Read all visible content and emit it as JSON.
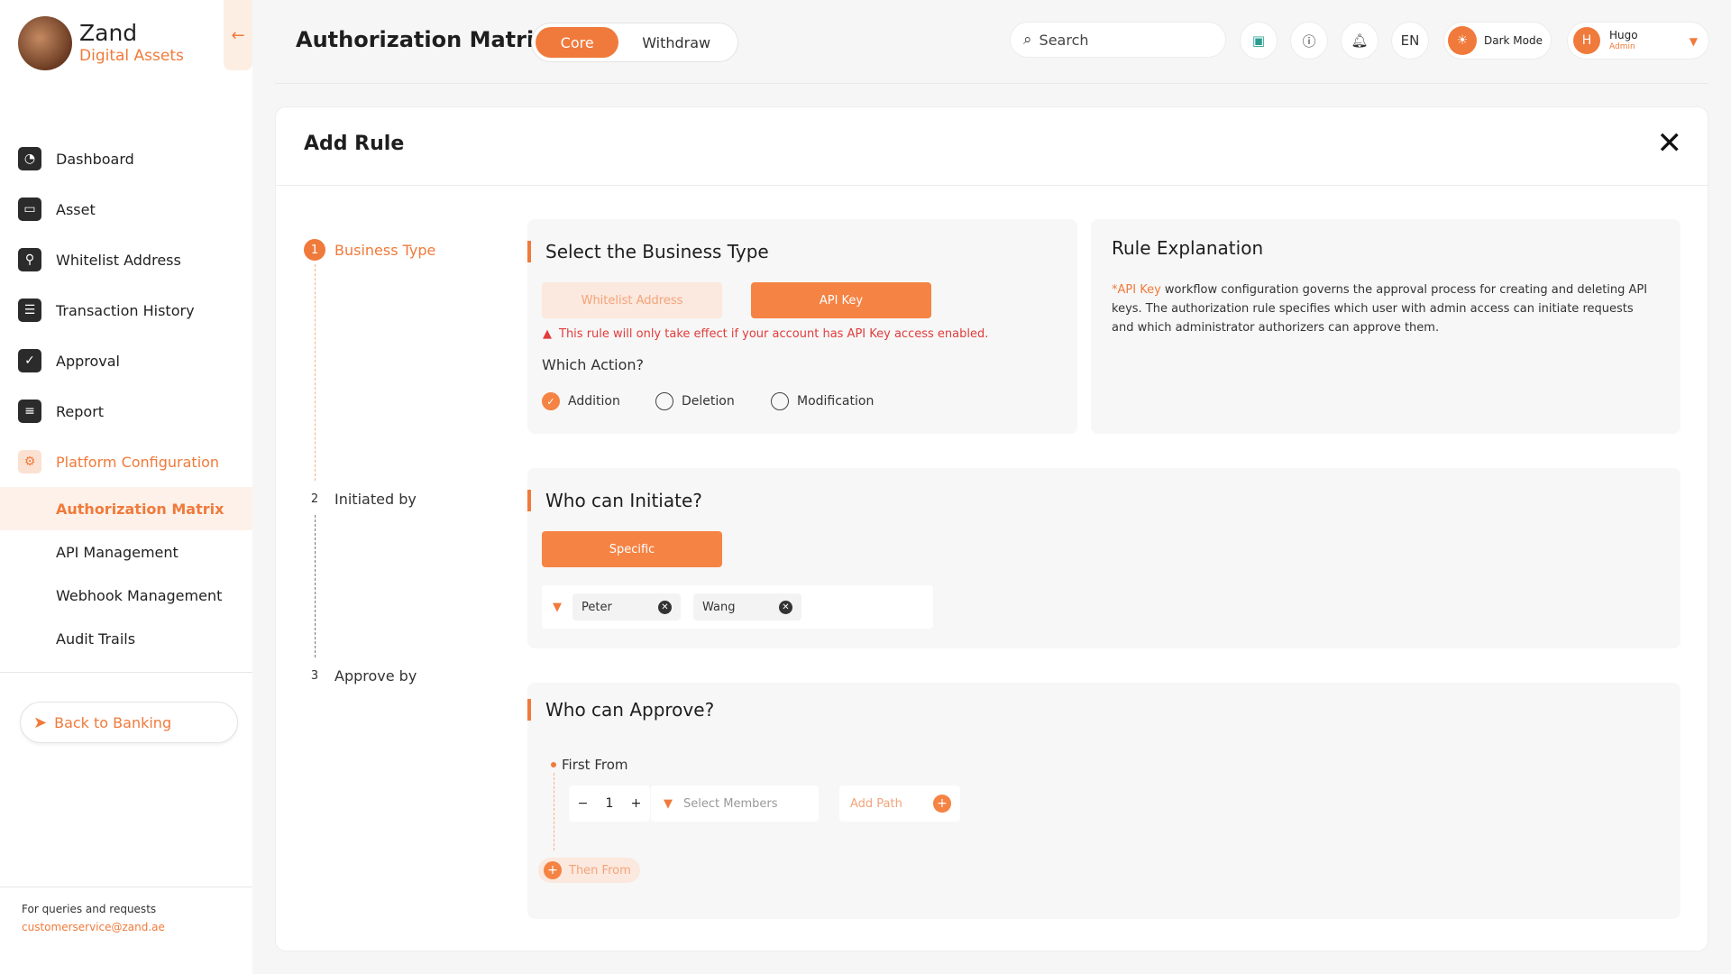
{
  "brand": {
    "name": "Zand",
    "subtitle": "Digital Assets",
    "logo_icon": "zand-logo"
  },
  "sidebar": {
    "collapse_icon": "arrow-left-icon",
    "items": [
      {
        "label": "Dashboard",
        "icon": "dashboard-icon"
      },
      {
        "label": "Asset",
        "icon": "wallet-icon"
      },
      {
        "label": "Whitelist Address",
        "icon": "location-pin-icon"
      },
      {
        "label": "Transaction History",
        "icon": "list-icon"
      },
      {
        "label": "Approval",
        "icon": "check-icon"
      },
      {
        "label": "Report",
        "icon": "report-icon"
      },
      {
        "label": "Platform Configuration",
        "icon": "settings-icon"
      }
    ],
    "subitems": [
      "Authorization Matrix",
      "API Management",
      "Webhook Management",
      "Audit Trails"
    ],
    "back_button": "Back to Banking",
    "footer_label": "For queries and requests",
    "footer_email": "customerservice@zand.ae"
  },
  "header": {
    "title": "Authorization Matrix",
    "tabs": [
      "Core",
      "Withdraw"
    ],
    "search_placeholder": "Search",
    "language": "EN",
    "dark_mode_label": "Dark Mode",
    "user_initial": "H",
    "user_name": "Hugo",
    "user_role": "Admin"
  },
  "card": {
    "title": "Add Rule",
    "steps": [
      {
        "num": "1",
        "label": "Business Type"
      },
      {
        "num": "2",
        "label": "Initiated by"
      },
      {
        "num": "3",
        "label": "Approve by"
      }
    ],
    "business": {
      "title": "Select the Business Type",
      "option_whitelist": "Whitelist Address",
      "option_api": "API Key",
      "warning": "This rule will only take effect if your account has API Key access enabled.",
      "action_label": "Which Action?",
      "actions": [
        "Addition",
        "Deletion",
        "Modification"
      ],
      "selected_action": "Addition"
    },
    "explanation": {
      "title": "Rule Explanation",
      "highlight": "*API Key",
      "text": " workflow configuration governs the approval process for creating and deleting API keys. The authorization rule specifies which user with admin access can initiate requests and which administrator authorizers can approve them."
    },
    "initiate": {
      "title": "Who can Initiate?",
      "button": "Specific",
      "chips": [
        "Peter",
        "Wang"
      ]
    },
    "approve": {
      "title": "Who can Approve?",
      "first_from": "First From",
      "count": "1",
      "members_placeholder": "Select Members",
      "add_path": "Add Path",
      "then_from": "Then From"
    }
  }
}
